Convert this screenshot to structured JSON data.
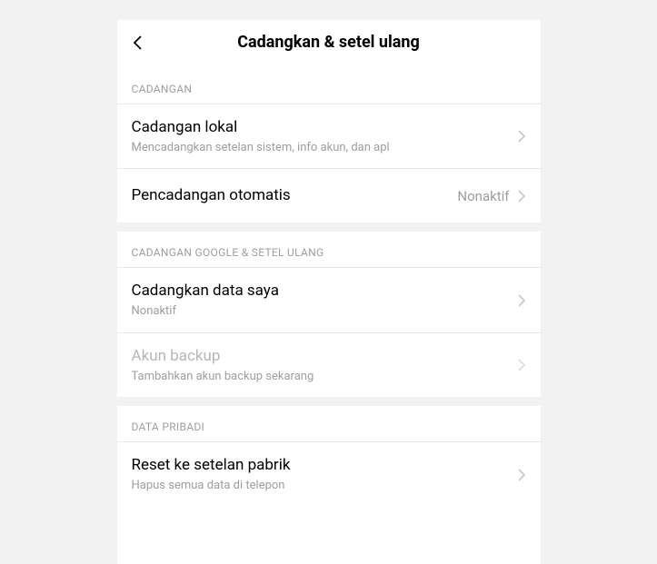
{
  "header": {
    "title": "Cadangkan & setel ulang"
  },
  "sections": {
    "backup": {
      "header": "CADANGAN",
      "local_backup": {
        "title": "Cadangan lokal",
        "sub": "Mencadangkan setelan sistem, info akun, dan apl"
      },
      "auto_backup": {
        "title": "Pencadangan otomatis",
        "value": "Nonaktif"
      }
    },
    "google": {
      "header": "CADANGAN GOOGLE & SETEL ULANG",
      "backup_my_data": {
        "title": "Cadangkan data saya",
        "sub": "Nonaktif"
      },
      "backup_account": {
        "title": "Akun backup",
        "sub": "Tambahkan akun backup sekarang"
      }
    },
    "personal": {
      "header": "DATA PRIBADI",
      "factory_reset": {
        "title": "Reset ke setelan pabrik",
        "sub": "Hapus semua data di telepon"
      }
    }
  }
}
